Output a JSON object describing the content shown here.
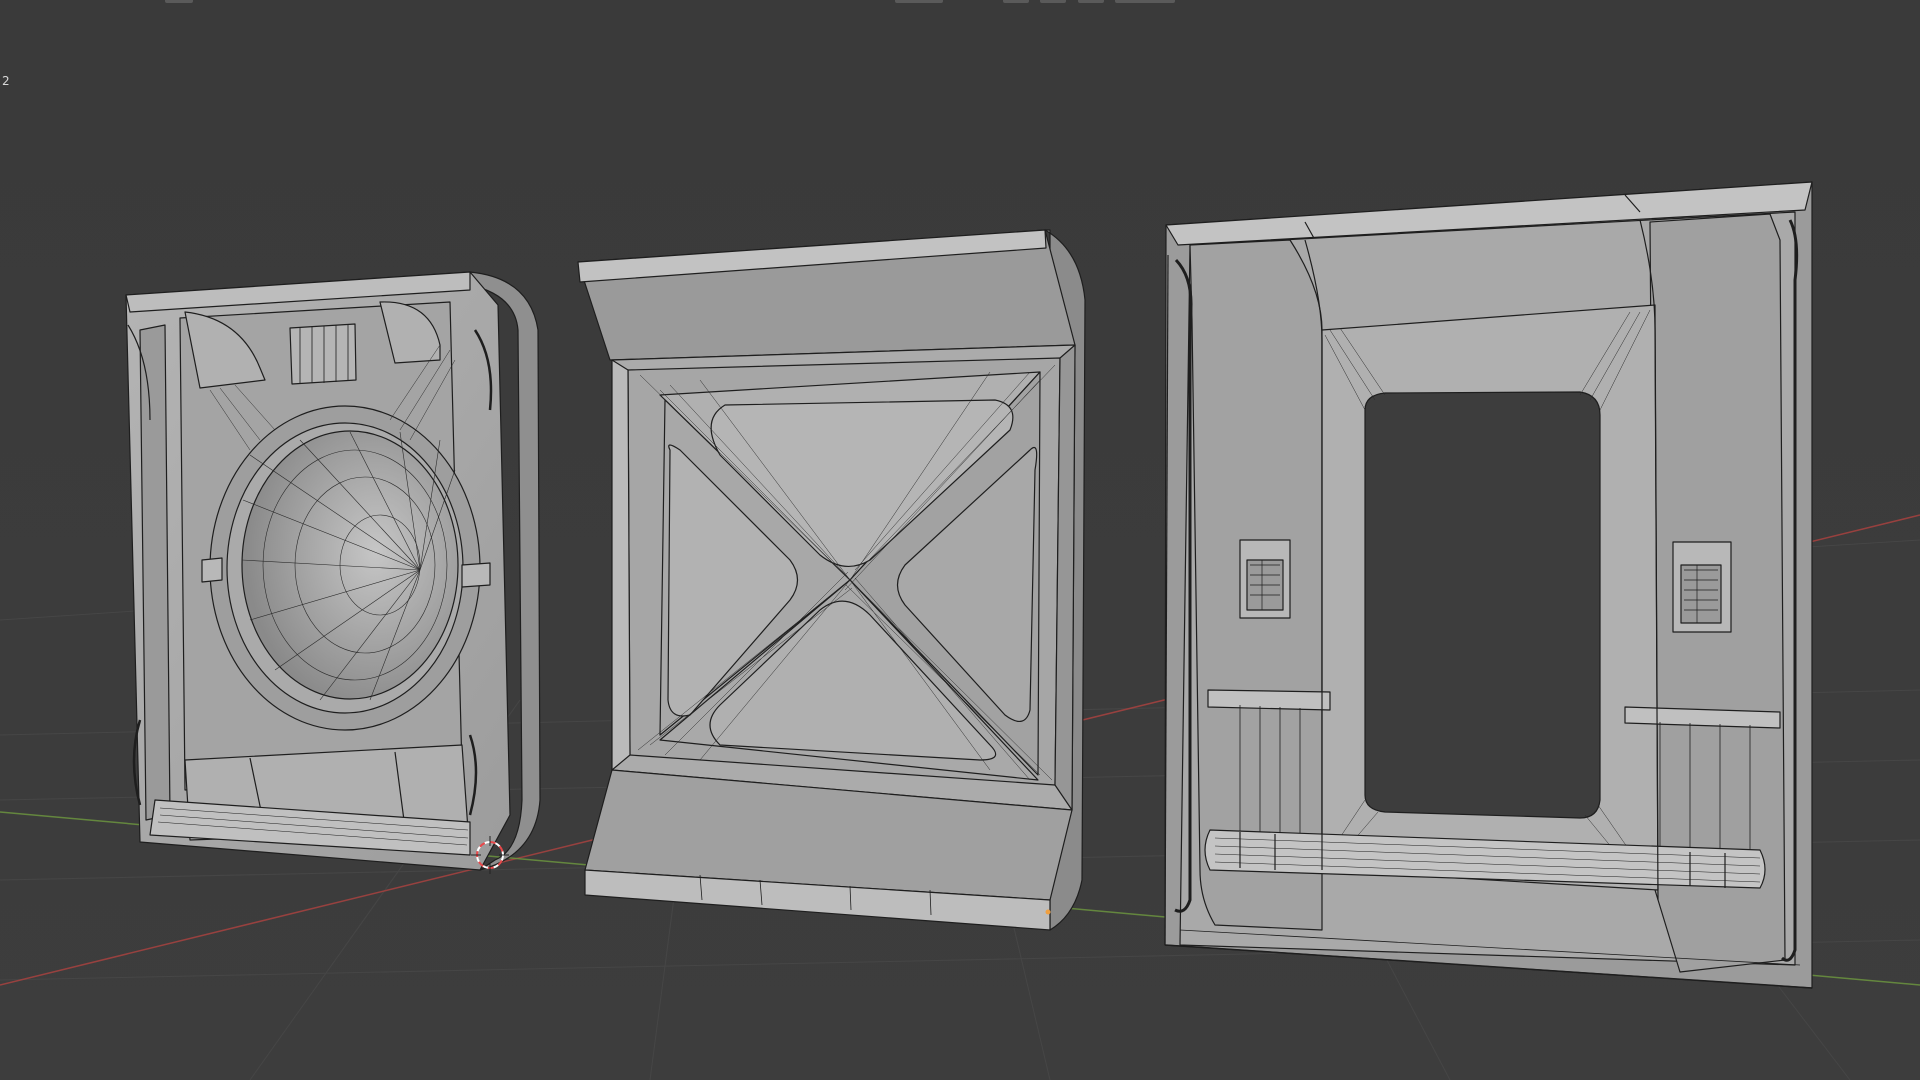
{
  "viewport": {
    "corner_label": "2"
  },
  "colors": {
    "background": "#3b3b3b",
    "mesh_face": "#a9a9a9",
    "mesh_face_light": "#b6b6b6",
    "mesh_face_dark": "#8e8e8e",
    "wire": "#1e1e1e",
    "grid_line": "#454545",
    "x_axis": "#a8423f",
    "y_axis": "#6e9a3e",
    "cursor_red": "#e8484a",
    "cursor_white": "#ffffff"
  },
  "objects": [
    {
      "name": "panel-porthole"
    },
    {
      "name": "panel-x-brace"
    },
    {
      "name": "panel-window-frame"
    }
  ]
}
